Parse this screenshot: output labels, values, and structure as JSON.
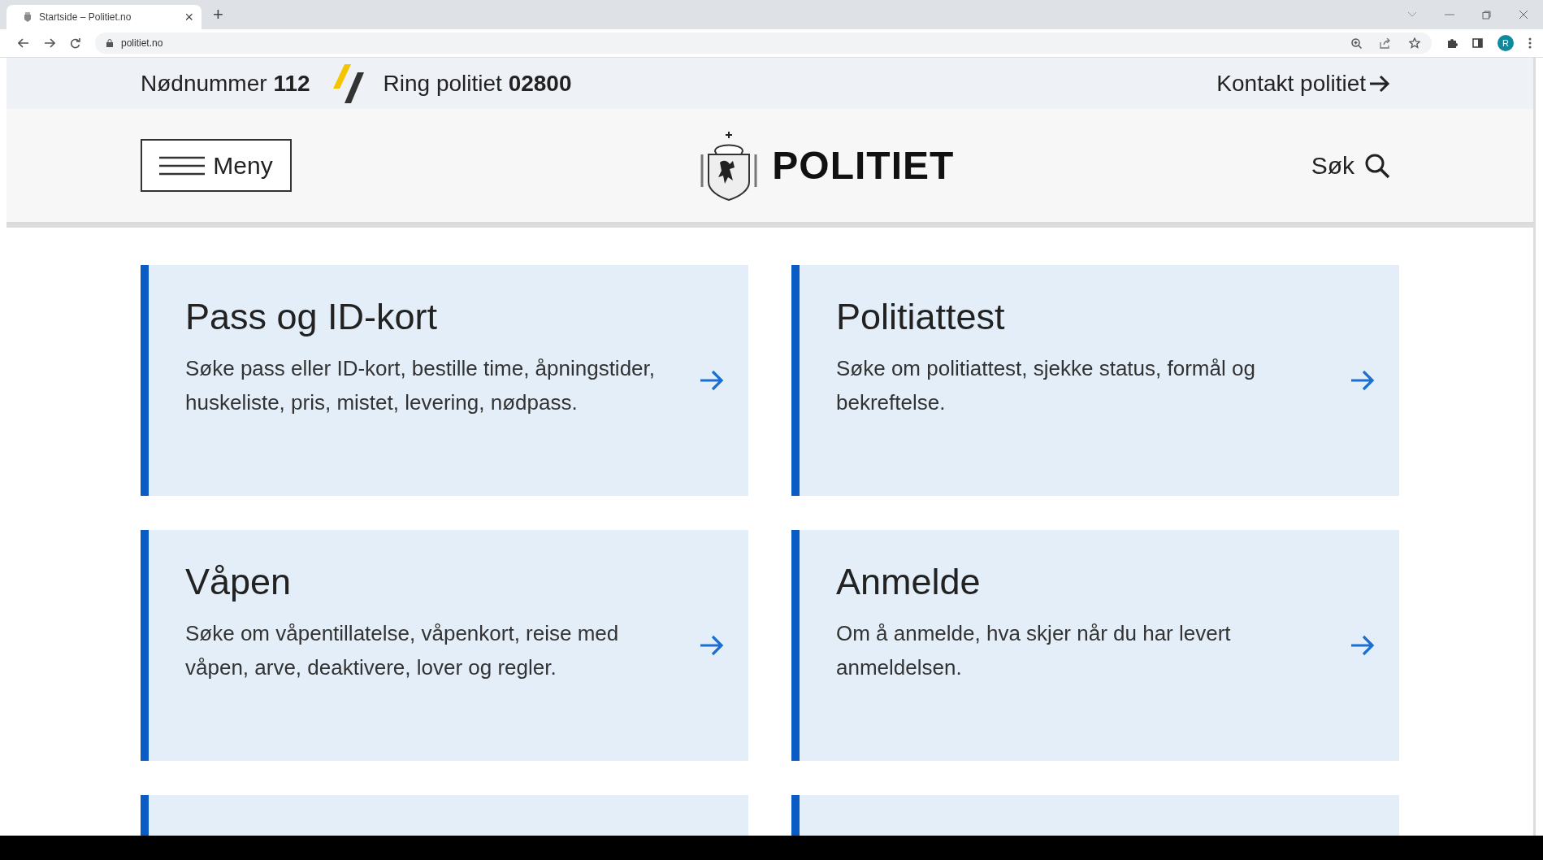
{
  "browser": {
    "tab_title": "Startside – Politiet.no",
    "tab_close": "×",
    "new_tab": "+",
    "url": "politiet.no",
    "profile_initial": "R"
  },
  "emergency_bar": {
    "emergency_label": "Nødnummer",
    "emergency_number": "112",
    "police_label": "Ring politiet",
    "police_number": "02800",
    "contact_link": "Kontakt politiet"
  },
  "header": {
    "menu_button": "Meny",
    "logo_text": "POLITIET",
    "search_button": "Søk"
  },
  "cards": [
    {
      "title": "Pass og ID-kort",
      "description": "Søke pass eller ID-kort, bestille time, åpningstider, huskeliste, pris, mistet, levering, nødpass."
    },
    {
      "title": "Politiattest",
      "description": "Søke om politiattest, sjekke status, formål og bekreftelse."
    },
    {
      "title": "Våpen",
      "description": "Søke om våpentillatelse, våpenkort, reise med våpen, arve, deaktivere, lover og regler."
    },
    {
      "title": "Anmelde",
      "description": "Om å anmelde, hva skjer når du har levert anmeldelsen."
    }
  ]
}
